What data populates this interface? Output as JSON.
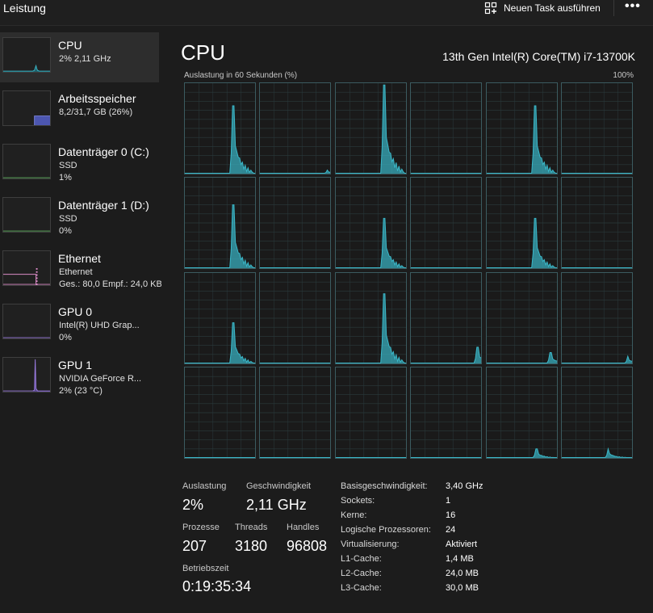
{
  "app": {
    "title": "Leistung"
  },
  "toolbar": {
    "new_task_label": "Neuen Task ausführen",
    "new_task_icon": "new-task-icon",
    "more_label": "•••"
  },
  "colors": {
    "cpu_accent": "#3ab7c8",
    "memory_accent": "#7983d8",
    "ethernet_accent": "#d98ac5",
    "gpu1_accent": "#9a7be0"
  },
  "sidebar": {
    "items": [
      {
        "name": "CPU",
        "line2": "2% 2,11 GHz",
        "line3": ""
      },
      {
        "name": "Arbeitsspeicher",
        "line2": "8,2/31,7 GB (26%)",
        "line3": ""
      },
      {
        "name": "Datenträger 0 (C:)",
        "line2": "SSD",
        "line3": "1%"
      },
      {
        "name": "Datenträger 1 (D:)",
        "line2": "SSD",
        "line3": "0%"
      },
      {
        "name": "Ethernet",
        "line2": "Ethernet",
        "line3": "Ges.: 80,0 Empf.: 24,0 KB"
      },
      {
        "name": "GPU 0",
        "line2": "Intel(R) UHD Grap...",
        "line3": "0%"
      },
      {
        "name": "GPU 1",
        "line2": "NVIDIA GeForce R...",
        "line3": "2% (23 °C)"
      }
    ]
  },
  "main": {
    "title": "CPU",
    "model": "13th Gen Intel(R) Core(TM) i7-13700K",
    "axis_left": "Auslastung in 60 Sekunden (%)",
    "axis_right": "100%"
  },
  "cores": [
    {
      "spike": 0.75,
      "pos": 0.68
    },
    {
      "spike": 0.04,
      "pos": 0.95
    },
    {
      "spike": 0.98,
      "pos": 0.68
    },
    {
      "spike": 0.0,
      "pos": 0.5
    },
    {
      "spike": 0.75,
      "pos": 0.68
    },
    {
      "spike": 0.0,
      "pos": 0.5
    },
    {
      "spike": 0.7,
      "pos": 0.68
    },
    {
      "spike": 0.0,
      "pos": 0.5
    },
    {
      "spike": 0.55,
      "pos": 0.68
    },
    {
      "spike": 0.0,
      "pos": 0.5
    },
    {
      "spike": 0.55,
      "pos": 0.68
    },
    {
      "spike": 0.0,
      "pos": 0.5
    },
    {
      "spike": 0.45,
      "pos": 0.68
    },
    {
      "spike": 0.0,
      "pos": 0.5
    },
    {
      "spike": 0.77,
      "pos": 0.68
    },
    {
      "spike": 0.18,
      "pos": 0.94
    },
    {
      "spike": 0.12,
      "pos": 0.9
    },
    {
      "spike": 0.08,
      "pos": 0.93
    },
    {
      "spike": 0.0,
      "pos": 0.5
    },
    {
      "spike": 0.0,
      "pos": 0.5
    },
    {
      "spike": 0.0,
      "pos": 0.5
    },
    {
      "spike": 0.0,
      "pos": 0.5
    },
    {
      "spike": 0.1,
      "pos": 0.7
    },
    {
      "spike": 0.1,
      "pos": 0.65
    }
  ],
  "stats": {
    "auslastung_label": "Auslastung",
    "auslastung_value": "2%",
    "speed_label": "Geschwindigkeit",
    "speed_value": "2,11 GHz",
    "processes_label": "Prozesse",
    "processes_value": "207",
    "threads_label": "Threads",
    "threads_value": "3180",
    "handles_label": "Handles",
    "handles_value": "96808",
    "uptime_label": "Betriebszeit",
    "uptime_value": "0:19:35:34"
  },
  "specs": [
    {
      "key": "Basisgeschwindigkeit:",
      "value": "3,40 GHz"
    },
    {
      "key": "Sockets:",
      "value": "1"
    },
    {
      "key": "Kerne:",
      "value": "16"
    },
    {
      "key": "Logische Prozessoren:",
      "value": "24"
    },
    {
      "key": "Virtualisierung:",
      "value": "Aktiviert"
    },
    {
      "key": "L1-Cache:",
      "value": "1,4 MB"
    },
    {
      "key": "L2-Cache:",
      "value": "24,0 MB"
    },
    {
      "key": "L3-Cache:",
      "value": "30,0 MB"
    }
  ]
}
